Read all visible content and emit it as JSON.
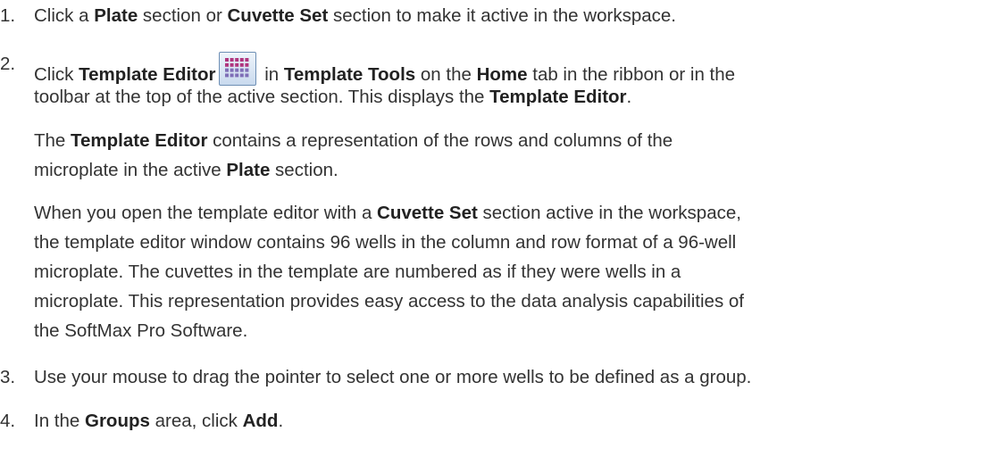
{
  "steps": [
    {
      "number": "1.",
      "parts": [
        {
          "t": "Click a "
        },
        {
          "t": "Plate",
          "b": true
        },
        {
          "t": " section or "
        },
        {
          "t": "Cuvette Set",
          "b": true
        },
        {
          "t": " section to make it active in the workspace."
        }
      ]
    },
    {
      "number": "2.",
      "parts": [
        {
          "t": "Click "
        },
        {
          "t": "Template Editor",
          "b": true
        },
        {
          "icon": "template-editor-icon"
        },
        {
          "t": " in "
        },
        {
          "t": "Template Tools",
          "b": true
        },
        {
          "t": " on the "
        },
        {
          "t": "Home",
          "b": true
        },
        {
          "t": " tab in the ribbon or in the"
        }
      ],
      "continuation": [
        [
          {
            "t": "toolbar at the top of the active section. This displays the "
          },
          {
            "t": "Template Editor",
            "b": true
          },
          {
            "t": "."
          }
        ]
      ],
      "paragraphs": [
        [
          [
            {
              "t": "The "
            },
            {
              "t": "Template Editor",
              "b": true
            },
            {
              "t": " contains a representation of the rows and columns of the"
            }
          ],
          [
            {
              "t": "microplate in the active "
            },
            {
              "t": "Plate",
              "b": true
            },
            {
              "t": " section."
            }
          ]
        ],
        [
          [
            {
              "t": "When you open the template editor with a "
            },
            {
              "t": "Cuvette Set",
              "b": true
            },
            {
              "t": " section active in the workspace,"
            }
          ],
          [
            {
              "t": "the template editor window contains 96 wells in the column and row format of a 96-well"
            }
          ],
          [
            {
              "t": "microplate. The cuvettes in the template are numbered as if they were wells in a"
            }
          ],
          [
            {
              "t": "microplate. This representation provides easy access to the data analysis capabilities of"
            }
          ],
          [
            {
              "t": "the SoftMax Pro Software."
            }
          ]
        ]
      ]
    },
    {
      "number": "3.",
      "parts": [
        {
          "t": "Use your mouse to drag the pointer to select one or more wells to be defined as a group."
        }
      ]
    },
    {
      "number": "4.",
      "parts": [
        {
          "t": "In the "
        },
        {
          "t": "Groups",
          "b": true
        },
        {
          "t": " area, click "
        },
        {
          "t": "Add",
          "b": true
        },
        {
          "t": "."
        }
      ]
    }
  ],
  "colors": {
    "text": "#333333",
    "icon_cells": "#b0357e",
    "icon_cells_alt": "#7f6fb7"
  }
}
